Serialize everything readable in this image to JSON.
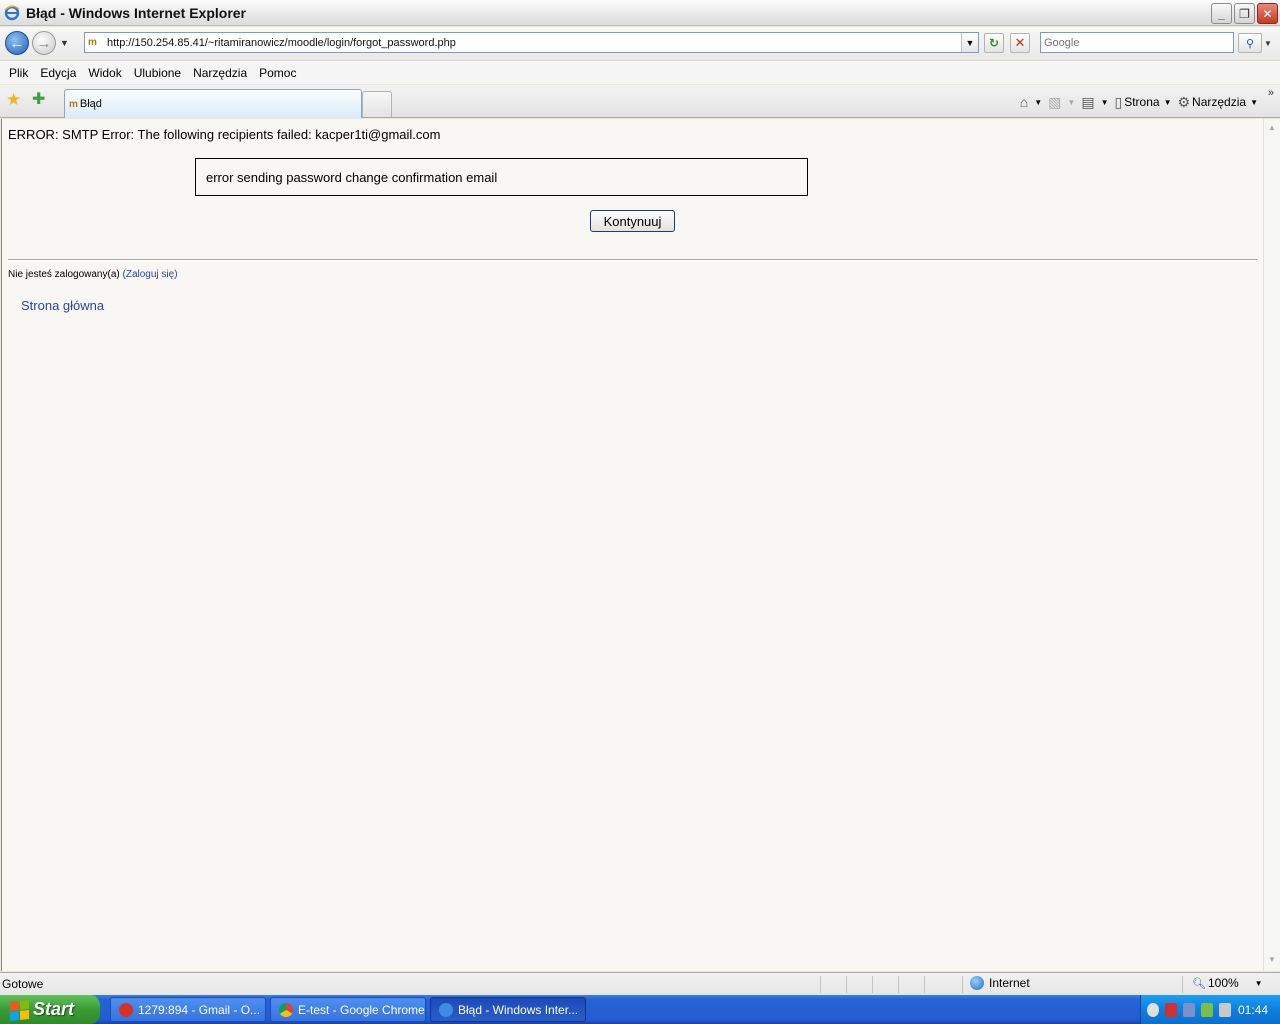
{
  "window": {
    "title": "Błąd - Windows Internet Explorer",
    "minimize_label": "_",
    "maximize_label": "❐",
    "close_label": "✕"
  },
  "address_bar": {
    "url": "http://150.254.85.41/~ritamiranowicz/moodle/login/forgot_password.php"
  },
  "search": {
    "placeholder": "Google"
  },
  "menu": {
    "items": [
      "Plik",
      "Edycja",
      "Widok",
      "Ulubione",
      "Narzędzia",
      "Pomoc"
    ]
  },
  "tab": {
    "label": "Błąd"
  },
  "command_bar": {
    "page_label": "Strona",
    "tools_label": "Narzędzia"
  },
  "page": {
    "error_line": "ERROR: SMTP Error: The following recipients failed: kacper1ti@gmail.com",
    "error_box": "error sending password change confirmation email",
    "continue_label": "Kontynuuj",
    "login_info_prefix": "Nie jesteś zalogowany(a) ",
    "login_link": "(Zaloguj się)",
    "home_link": "Strona główna"
  },
  "status_bar": {
    "status": "Gotowe",
    "zone": "Internet",
    "zoom": "100%"
  },
  "taskbar": {
    "start_label": "Start",
    "items": [
      {
        "label": "1279:894 - Gmail - O...",
        "icon_color": "#d93025"
      },
      {
        "label": "E-test - Google Chrome",
        "icon_color": "#f4c20d"
      },
      {
        "label": "Błąd - Windows Inter...",
        "icon_color": "#3b8ce3"
      }
    ],
    "clock": "01:44"
  },
  "colors": {
    "link": "#2a47a8",
    "taskbar": "#245cd0",
    "start": "#3a9b34"
  }
}
